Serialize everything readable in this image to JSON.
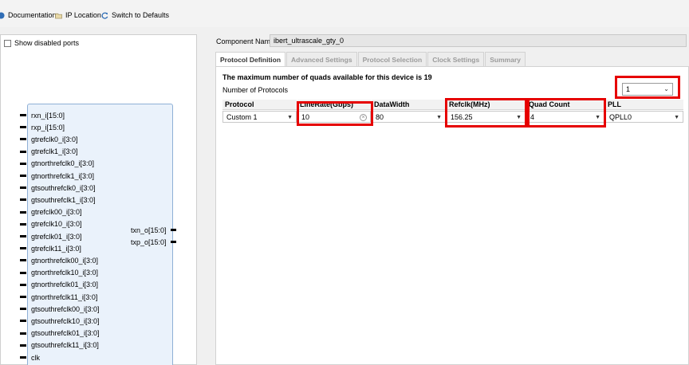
{
  "toolbar": {
    "documentation": "Documentation",
    "ip_location": "IP Location",
    "switch_defaults": "Switch to Defaults"
  },
  "left_panel": {
    "show_disabled_ports": "Show disabled ports",
    "inputs": [
      "rxn_i[15:0]",
      "rxp_i[15:0]",
      "gtrefclk0_i[3:0]",
      "gtrefclk1_i[3:0]",
      "gtnorthrefclk0_i[3:0]",
      "gtnorthrefclk1_i[3:0]",
      "gtsouthrefclk0_i[3:0]",
      "gtsouthrefclk1_i[3:0]",
      "gtrefclk00_i[3:0]",
      "gtrefclk10_i[3:0]",
      "gtrefclk01_i[3:0]",
      "gtrefclk11_i[3:0]",
      "gtnorthrefclk00_i[3:0]",
      "gtnorthrefclk10_i[3:0]",
      "gtnorthrefclk01_i[3:0]",
      "gtnorthrefclk11_i[3:0]",
      "gtsouthrefclk00_i[3:0]",
      "gtsouthrefclk10_i[3:0]",
      "gtsouthrefclk01_i[3:0]",
      "gtsouthrefclk11_i[3:0]",
      "clk"
    ],
    "outputs": [
      "txn_o[15:0]",
      "txp_o[15:0]"
    ]
  },
  "component": {
    "label": "Component Name",
    "value": "ibert_ultrascale_gty_0"
  },
  "tabs": [
    "Protocol Definition",
    "Advanced Settings",
    "Protocol Selection",
    "Clock Settings",
    "Summary"
  ],
  "protocol": {
    "max_quads_text": "The maximum number of quads available for this device is 19",
    "num_protocols_label": "Number of Protocols",
    "num_protocols_value": "1",
    "headers": [
      "Protocol",
      "LineRate(Gbps)",
      "DataWidth",
      "Refclk(MHz)",
      "Quad Count",
      "PLL"
    ],
    "row": [
      "Custom 1",
      "10",
      "80",
      "156.25",
      "4",
      "QPLL0"
    ]
  },
  "icons": {
    "documentation": "documentation-dot-icon",
    "ip_location": "folder-icon",
    "switch_defaults": "refresh-icon"
  },
  "colors": {
    "highlight": "#e60000",
    "block_fill": "#eaf2fb",
    "block_border": "#8fb0d6"
  }
}
